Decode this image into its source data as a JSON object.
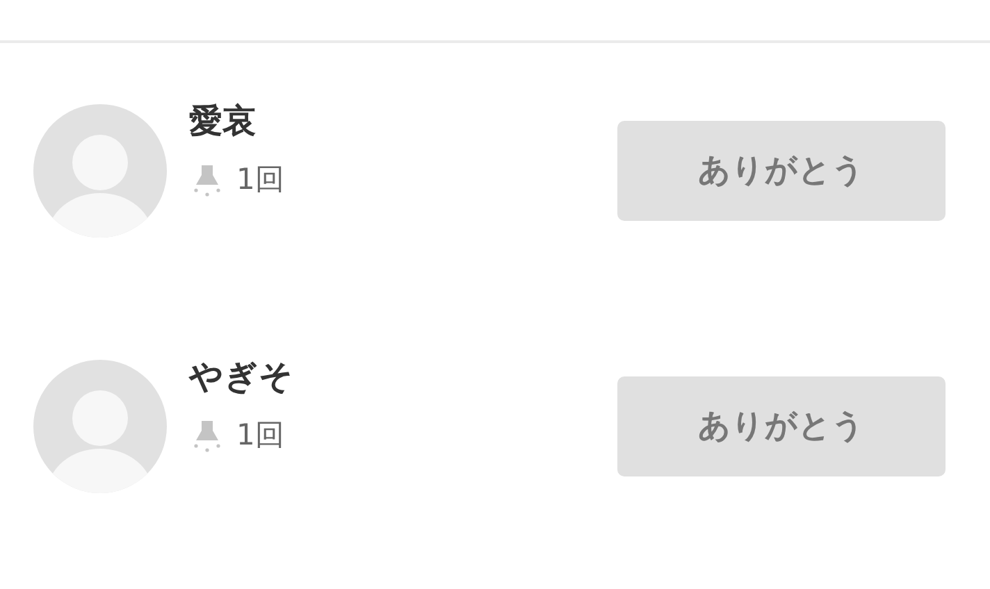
{
  "users": [
    {
      "name": "愛哀",
      "count": "1回",
      "button": "ありがとう"
    },
    {
      "name": "やぎそ",
      "count": "1回",
      "button": "ありがとう"
    }
  ]
}
